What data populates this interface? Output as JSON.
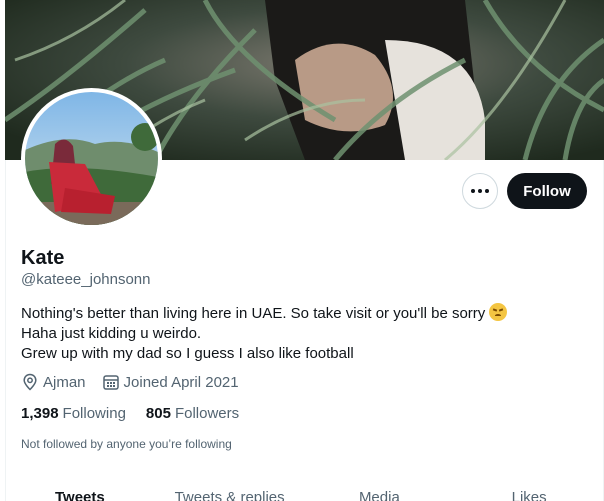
{
  "profile": {
    "name": "Kate",
    "handle": "@kateee_johnsonn",
    "bio_lines": [
      "Nothing's better than living here in UAE. So take visit or you'll be sorry",
      "Haha just kidding u weirdo.",
      "Grew up with my dad so I guess I also like football"
    ],
    "bio_emoji": "angry-face-emoji",
    "location": "Ajman",
    "joined": "Joined April 2021",
    "following_count": "1,398",
    "following_label": "Following",
    "followers_count": "805",
    "followers_label": "Followers",
    "not_followed_text": "Not followed by anyone you’re following"
  },
  "actions": {
    "more_icon": "more-horizontal-icon",
    "follow_label": "Follow"
  },
  "tabs": [
    {
      "label": "Tweets",
      "active": true
    },
    {
      "label": "Tweets & replies",
      "active": false
    },
    {
      "label": "Media",
      "active": false
    },
    {
      "label": "Likes",
      "active": false
    }
  ],
  "icons": {
    "location": "location-pin-icon",
    "calendar": "calendar-icon"
  },
  "colors": {
    "text_primary": "#0f1419",
    "text_secondary": "#536471",
    "follow_bg": "#0f1419",
    "border": "#cfd9de"
  }
}
